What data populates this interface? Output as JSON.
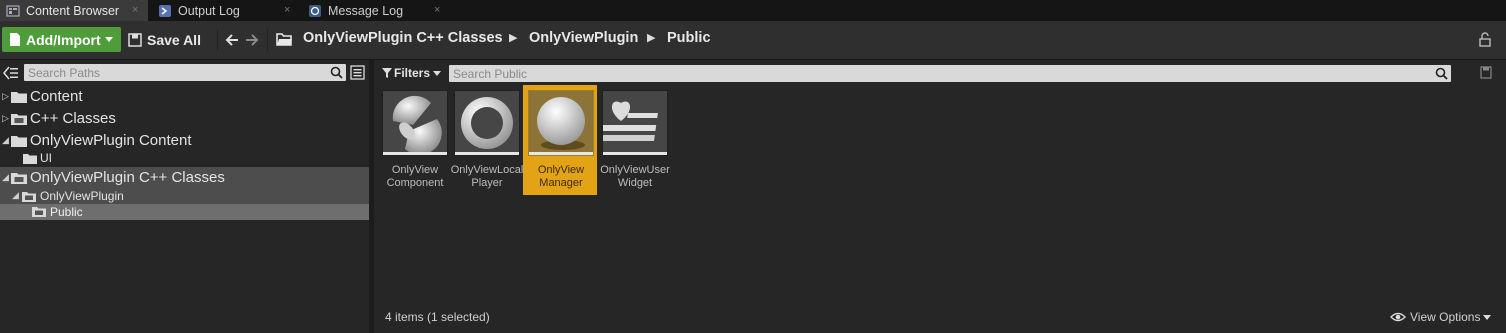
{
  "tabs": [
    {
      "label": "Content Browser",
      "icon": "content-browser-icon",
      "active": true
    },
    {
      "label": "Output Log",
      "icon": "output-log-icon",
      "active": false
    },
    {
      "label": "Message Log",
      "icon": "message-log-icon",
      "active": false
    }
  ],
  "tab_close": "×",
  "toolbar": {
    "add_import_label": "Add/Import",
    "save_all_label": "Save All",
    "breadcrumb": [
      "OnlyViewPlugin C++ Classes",
      "OnlyViewPlugin",
      "Public"
    ]
  },
  "sidebar": {
    "search_placeholder": "Search Paths",
    "tree": [
      {
        "label": "Content"
      },
      {
        "label": "C++ Classes"
      },
      {
        "label": "OnlyViewPlugin Content"
      },
      {
        "label": "UI"
      },
      {
        "label": "OnlyViewPlugin C++ Classes"
      },
      {
        "label": "OnlyViewPlugin"
      },
      {
        "label": "Public"
      }
    ]
  },
  "content": {
    "filters_label": "Filters",
    "search_placeholder": "Search Public",
    "assets": [
      {
        "line1": "OnlyView",
        "line2": "Component",
        "icon": "component-sphere-icon"
      },
      {
        "line1": "OnlyViewLocal",
        "line2": "Player",
        "icon": "ring-icon"
      },
      {
        "line1": "OnlyView",
        "line2": "Manager",
        "icon": "sphere-icon",
        "selected": true
      },
      {
        "line1": "OnlyViewUser",
        "line2": "Widget",
        "icon": "heart-widget-icon"
      }
    ],
    "status": "4 items (1 selected)",
    "view_options_label": "View Options"
  },
  "colors": {
    "accent_green": "#4f9c3a",
    "selection_gold": "#e3a317"
  }
}
